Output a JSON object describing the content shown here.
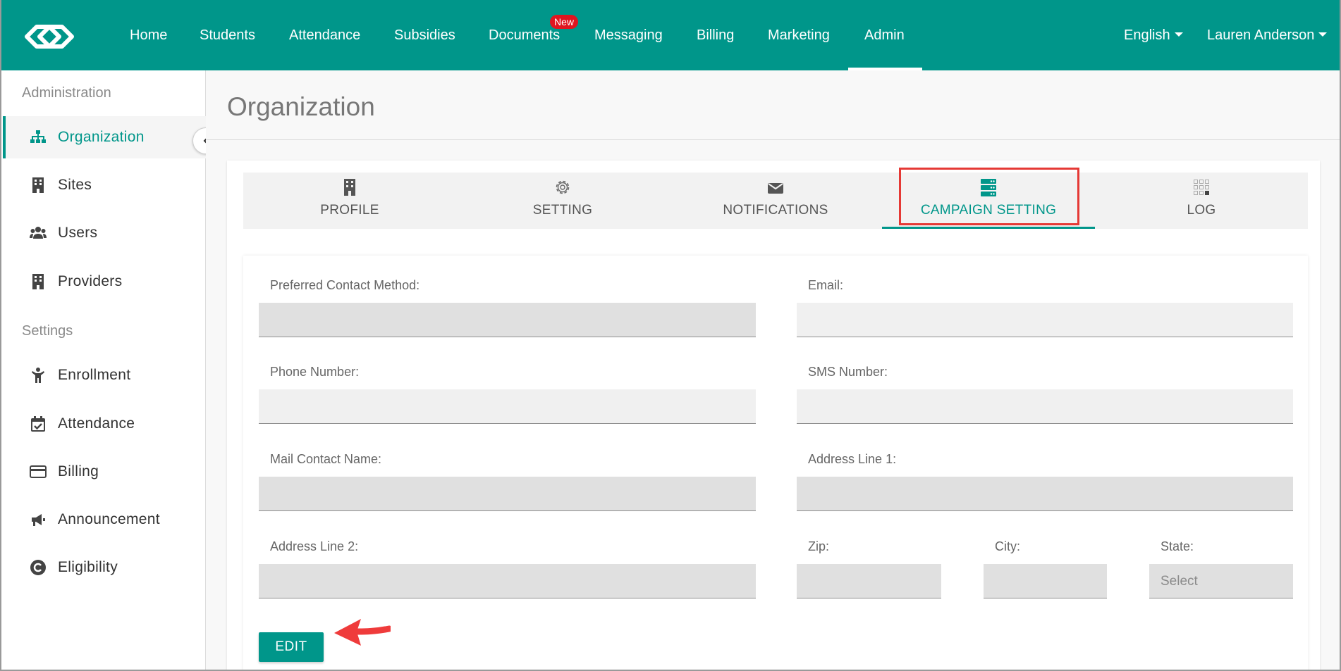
{
  "nav": {
    "items": [
      "Home",
      "Students",
      "Attendance",
      "Subsidies",
      "Documents",
      "Messaging",
      "Billing",
      "Marketing",
      "Admin"
    ],
    "active": "Admin",
    "documents_badge": "New",
    "language": "English",
    "user": "Lauren Anderson",
    "brand_color": "#00968a"
  },
  "sidebar": {
    "sections": [
      {
        "heading": "Administration",
        "items": [
          {
            "label": "Organization",
            "icon": "sitemap-icon"
          },
          {
            "label": "Sites",
            "icon": "building-icon"
          },
          {
            "label": "Users",
            "icon": "users-icon"
          },
          {
            "label": "Providers",
            "icon": "building-icon"
          }
        ]
      },
      {
        "heading": "Settings",
        "items": [
          {
            "label": "Enrollment",
            "icon": "child-icon"
          },
          {
            "label": "Attendance",
            "icon": "calendar-check-icon"
          },
          {
            "label": "Billing",
            "icon": "credit-card-icon"
          },
          {
            "label": "Announcement",
            "icon": "megaphone-icon"
          },
          {
            "label": "Eligibility",
            "icon": "copyright-icon"
          }
        ]
      }
    ],
    "active": "Organization"
  },
  "page": {
    "title": "Organization"
  },
  "tabs": {
    "items": [
      {
        "label": "PROFILE",
        "icon": "building-icon"
      },
      {
        "label": "SETTING",
        "icon": "gear-icon"
      },
      {
        "label": "NOTIFICATIONS",
        "icon": "envelope-icon"
      },
      {
        "label": "CAMPAIGN SETTING",
        "icon": "server-icon"
      },
      {
        "label": "LOG",
        "icon": "grid-icon"
      }
    ],
    "active": "CAMPAIGN SETTING"
  },
  "form": {
    "preferred_contact_method": {
      "label": "Preferred Contact Method:",
      "value": ""
    },
    "email": {
      "label": "Email:",
      "value": ""
    },
    "phone_number": {
      "label": "Phone Number:",
      "value": ""
    },
    "sms_number": {
      "label": "SMS Number:",
      "value": ""
    },
    "mail_contact_name": {
      "label": "Mail Contact Name:",
      "value": ""
    },
    "address_line_1": {
      "label": "Address Line 1:",
      "value": ""
    },
    "address_line_2": {
      "label": "Address Line 2:",
      "value": ""
    },
    "zip": {
      "label": "Zip:",
      "value": ""
    },
    "city": {
      "label": "City:",
      "value": ""
    },
    "state": {
      "label": "State:",
      "placeholder": "Select"
    },
    "edit_label": "EDIT"
  },
  "annotation_color": "#e53935"
}
